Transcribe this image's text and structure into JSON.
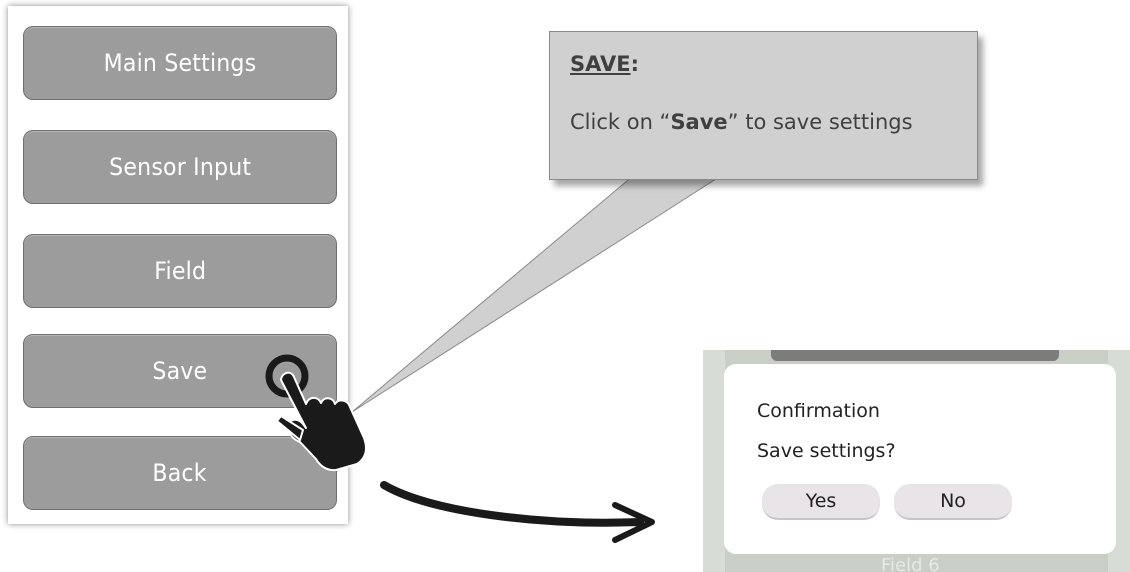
{
  "menu": {
    "buttons": [
      {
        "label": "Main Settings"
      },
      {
        "label": "Sensor Input"
      },
      {
        "label": "Field"
      },
      {
        "label": "Save"
      },
      {
        "label": "Back"
      }
    ]
  },
  "callout": {
    "title": "SAVE",
    "title_suffix": ":",
    "text_before": "Click on “",
    "text_bold": "Save",
    "text_after": "” to save settings"
  },
  "dialog": {
    "title": "Confirmation",
    "message": "Save settings?",
    "yes_label": "Yes",
    "no_label": "No",
    "background_label": "Field 6"
  },
  "icons": {
    "hand": "hand-pointer-icon",
    "tap": "tap-ring-icon",
    "arrow": "curved-arrow-icon"
  },
  "colors": {
    "menu_button": "#9c9c9c",
    "callout": "#d0d0d0",
    "dialog_button": "#e8e4e8"
  }
}
